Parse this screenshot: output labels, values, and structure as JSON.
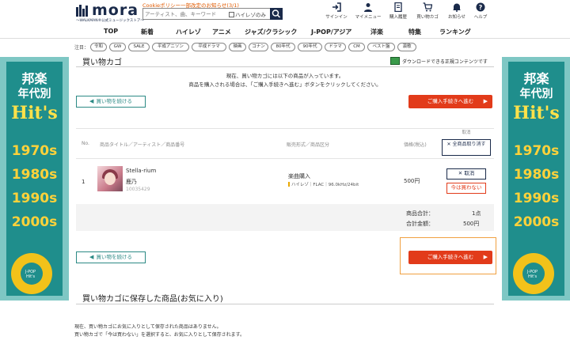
{
  "header": {
    "logo_text": "mora",
    "logo_sub": "〜WALKMAN®公式ミュージックストア〜",
    "notice": "Cookieポリシー一部改定のお知らせ(3/1)",
    "search_placeholder": "アーティスト、曲、キーワード",
    "hires_only_label": "ハイレゾのみ",
    "icons": [
      {
        "name": "signin-icon",
        "label": "サインイン"
      },
      {
        "name": "mymenu-icon",
        "label": "マイメニュー"
      },
      {
        "name": "history-icon",
        "label": "購入履歴"
      },
      {
        "name": "cart-icon",
        "label": "買い物カゴ"
      },
      {
        "name": "bell-icon",
        "label": "お知らせ"
      },
      {
        "name": "help-icon",
        "label": "ヘルプ"
      }
    ]
  },
  "nav": [
    "TOP",
    "新着",
    "ハイレゾ",
    "アニメ",
    "ジャズ/クラシック",
    "J-POP/アジア",
    "洋楽",
    "特集",
    "ランキング"
  ],
  "tags": {
    "label": "注目：",
    "items": [
      "令和",
      "GW",
      "SALE",
      "平成アニソン",
      "平成ドラマ",
      "映画",
      "コナン",
      "80年代",
      "90年代",
      "ドラマ",
      "CM",
      "ベスト盤",
      "演歌"
    ]
  },
  "banner": {
    "title1": "邦楽",
    "title2": "年代別",
    "hits": "Hit's",
    "years": [
      "1970s",
      "1980s",
      "1990s",
      "2000s"
    ],
    "disc_text1": "J-POP",
    "disc_text2": "Hit's"
  },
  "cart": {
    "title": "買い物カゴ",
    "download_note": "ダウンロードできる正規コンテンツです",
    "info1": "現在、買い物カゴには以下の商品が入っています。",
    "info2": "商品を購入される場合は、「ご購入手続きへ進む」ボタンをクリックしてください。",
    "continue_label": "買い物を続ける",
    "checkout_label": "ご購入手続きへ進む",
    "columns": {
      "no": "No.",
      "title": "商品タイトル／アーティスト／商品番号",
      "format": "販売形式／商品区分",
      "price": "価格(税込)",
      "delete": "取消"
    },
    "delete_all_label": "✕ 全商品取り消す",
    "item": {
      "no": "1",
      "title": "Stella-rium",
      "artist": "鹿乃",
      "id": "10035429",
      "format": "楽曲購入",
      "quality": "ハイレゾ｜FLAC｜96.0kHz/24bit",
      "price": "500円",
      "cancel_label": "✕ 取消",
      "not_now_label": "今は買わない"
    },
    "summary": {
      "count_label": "商品合計：",
      "count_value": "1点",
      "total_label": "合計金額：",
      "total_value": "500円"
    }
  },
  "saved": {
    "title": "買い物カゴに保存した商品(お気に入り)",
    "msg1": "現在、買い物カゴにお気に入りとして保存された商品はありません。",
    "msg2": "買い物カゴで「今は買わない」を選択すると、お気に入りとして保存されます。"
  }
}
